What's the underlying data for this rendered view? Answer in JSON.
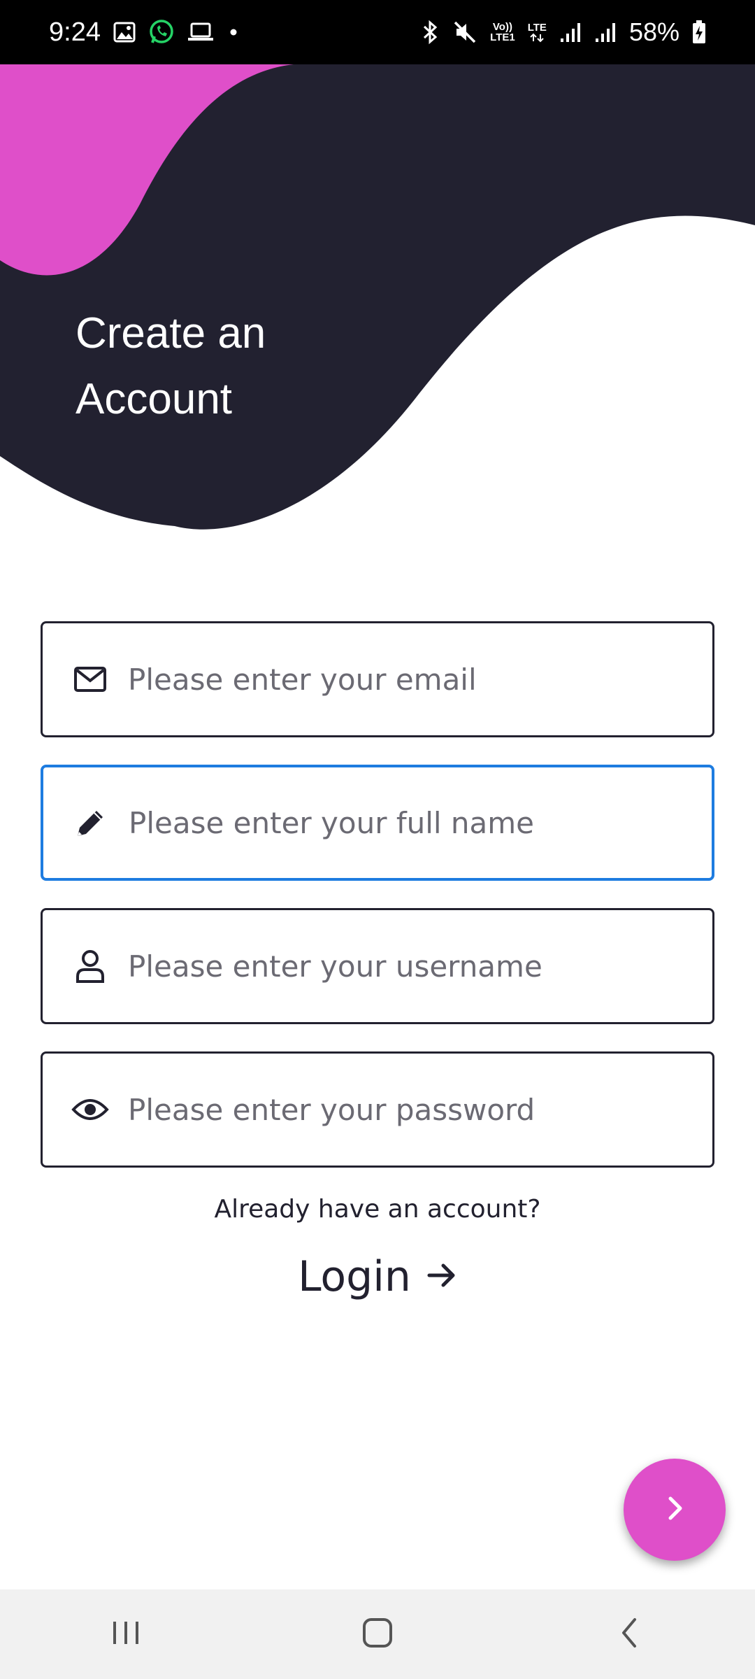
{
  "status_bar": {
    "time": "9:24",
    "left_icons": [
      "gallery-icon",
      "whatsapp-icon",
      "laptop-icon",
      "dot-icon"
    ],
    "network_volte": "Vo))",
    "network_lte1": "LTE1",
    "network_lte": "LTE",
    "battery": "58%"
  },
  "header": {
    "title": "Create an Account",
    "colors": {
      "dark": "#222130",
      "accent": "#df4fc9"
    }
  },
  "form": {
    "email": {
      "placeholder": "Please enter your email",
      "value": "",
      "icon": "envelope-icon"
    },
    "full_name": {
      "placeholder": "Please enter your full name",
      "value": "",
      "icon": "pencil-icon",
      "focused": true
    },
    "username": {
      "placeholder": "Please enter your username",
      "value": "",
      "icon": "user-icon"
    },
    "password": {
      "placeholder": "Please enter your password",
      "value": "",
      "icon": "eye-icon"
    }
  },
  "login": {
    "prompt": "Already have an account?",
    "label": "Login",
    "icon": "arrow-right-icon"
  },
  "fab": {
    "icon": "chevron-right-icon",
    "color": "#df4fc9"
  },
  "nav_bar": {
    "buttons": [
      "recent-apps-icon",
      "home-icon",
      "back-icon"
    ]
  },
  "colors": {
    "focus": "#1e7ce0",
    "text": "#22212f",
    "placeholder": "#6b6a73"
  }
}
